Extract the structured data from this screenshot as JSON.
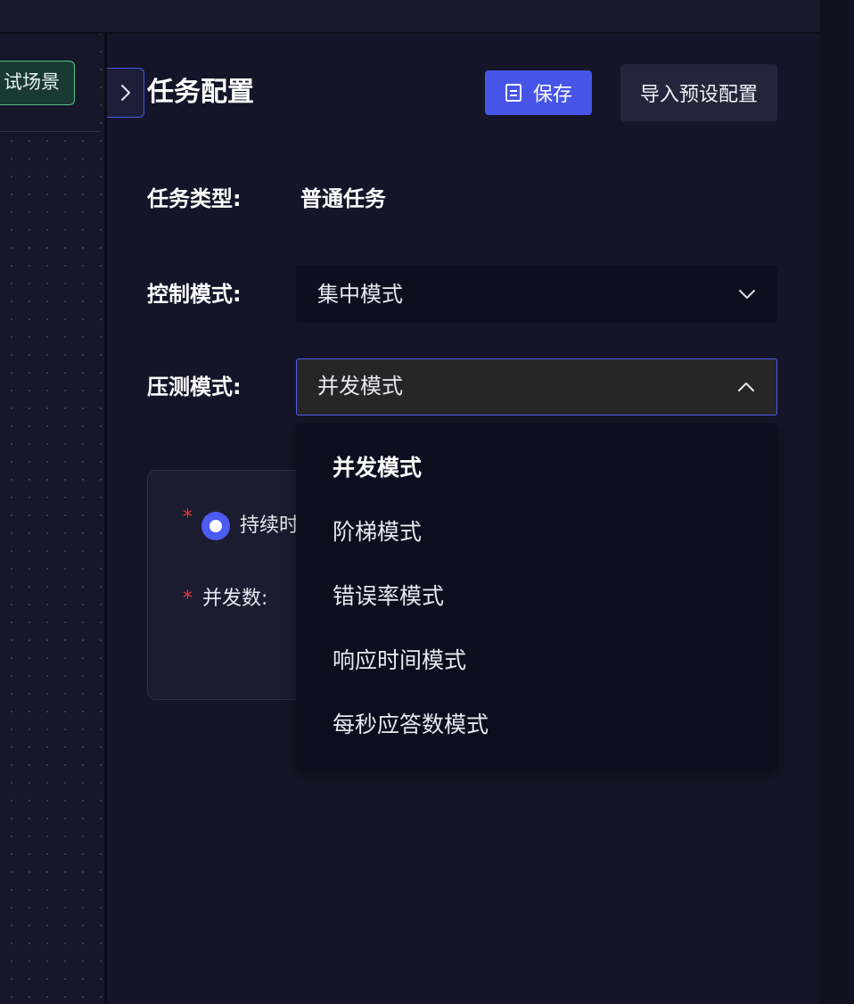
{
  "canvas": {
    "scene_tag_label": "试场景"
  },
  "panel": {
    "title": "任务配置",
    "save_label": "保存",
    "import_label": "导入预设配置"
  },
  "form": {
    "task_type_label": "任务类型:",
    "task_type_value": "普通任务",
    "control_mode_label": "控制模式:",
    "control_mode_value": "集中模式",
    "pressure_mode_label": "压测模式:",
    "pressure_mode_value": "并发模式"
  },
  "config_card": {
    "required_mark": "*",
    "duration_label": "持续时",
    "concurrency_label": "并发数:"
  },
  "dropdown": {
    "options": [
      "并发模式",
      "阶梯模式",
      "错误率模式",
      "响应时间模式",
      "每秒应答数模式"
    ],
    "selected": "并发模式"
  },
  "colors": {
    "accent": "#4655e8",
    "scene_tag_border": "#4fc385",
    "required": "#e23a3a"
  }
}
